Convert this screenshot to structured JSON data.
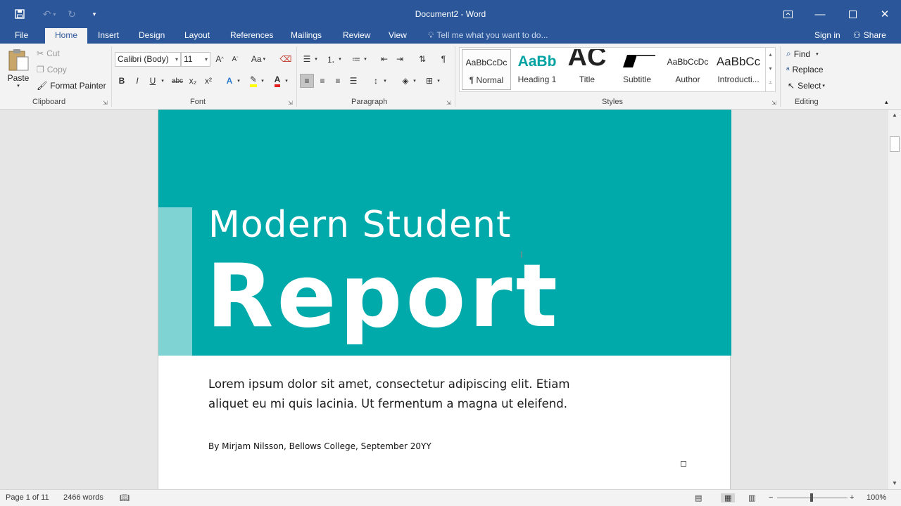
{
  "titlebar": {
    "doc_title": "Document2 - Word",
    "qat": {
      "save_icon": "save-icon",
      "undo_icon": "undo-icon",
      "redo_icon": "redo-icon",
      "customize_icon": "customize-qat-icon"
    }
  },
  "tabs": {
    "file": "File",
    "home": "Home",
    "insert": "Insert",
    "design": "Design",
    "layout": "Layout",
    "references": "References",
    "mailings": "Mailings",
    "review": "Review",
    "view": "View",
    "tell_me": "Tell me what you want to do...",
    "sign_in": "Sign in",
    "share": "Share"
  },
  "ribbon": {
    "clipboard": {
      "label": "Clipboard",
      "paste": "Paste",
      "cut": "Cut",
      "copy": "Copy",
      "format_painter": "Format Painter"
    },
    "font": {
      "label": "Font",
      "font_name": "Calibri (Body)",
      "font_size": "11",
      "change_case": "Aa",
      "bold": "B",
      "italic": "I",
      "underline": "U",
      "strike": "abc",
      "subscript": "x₂",
      "superscript": "x²"
    },
    "paragraph": {
      "label": "Paragraph"
    },
    "styles": {
      "label": "Styles",
      "items": [
        {
          "preview": "AaBbCcDc",
          "name": "¶ Normal"
        },
        {
          "preview": "AaBb",
          "name": "Heading 1"
        },
        {
          "preview": "AC",
          "name": "Title"
        },
        {
          "preview": "",
          "name": "Subtitle"
        },
        {
          "preview": "AaBbCcDc",
          "name": "Author"
        },
        {
          "preview": "AaBbCc",
          "name": "Introducti..."
        }
      ]
    },
    "editing": {
      "label": "Editing",
      "find": "Find",
      "replace": "Replace",
      "select": "Select"
    }
  },
  "document": {
    "subtitle": "Modern Student",
    "title": "Report",
    "body": "Lorem ipsum dolor sit amet, consectetur adipiscing elit. Etiam aliquet eu mi quis lacinia. Ut fermentum a magna ut eleifend.",
    "byline": "By Mirjam Nilsson, Bellows College, September 20YY",
    "cover_color": "#00aaaa",
    "accent_color": "#7fd3d3"
  },
  "status": {
    "page": "Page 1 of 11",
    "words": "2466 words",
    "zoom": "100%"
  },
  "colors": {
    "brand": "#2b579a",
    "ribbon_bg": "#f3f3f3"
  }
}
